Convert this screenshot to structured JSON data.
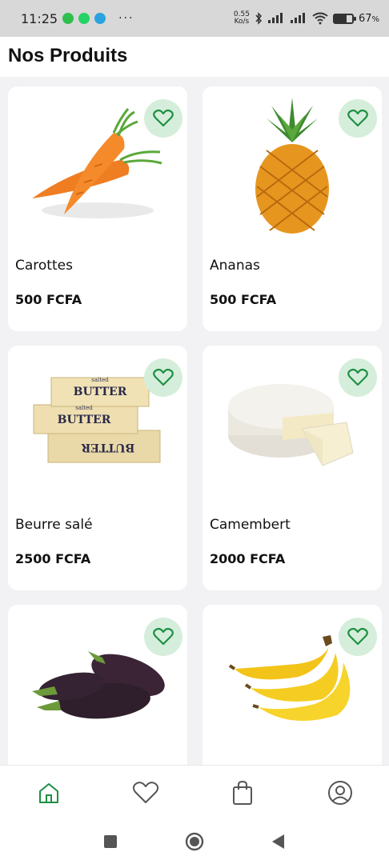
{
  "status_bar": {
    "time": "11:25",
    "apps": [
      "messages-icon",
      "whatsapp-icon",
      "telegram-icon"
    ],
    "more": "···",
    "speed_value": "0.55",
    "speed_unit": "Ko/s",
    "battery_percent": "67",
    "battery_suffix": "%",
    "battery_level": 0.67
  },
  "header": {
    "title": "Nos Produits"
  },
  "colors": {
    "accent": "#1e8f44",
    "fav_bg": "#d5eedb",
    "page_bg": "#f2f2f4"
  },
  "products": [
    {
      "name": "Carottes",
      "price": "500 FCFA",
      "image": "carrot-image"
    },
    {
      "name": "Ananas",
      "price": "500 FCFA",
      "image": "pineapple-image"
    },
    {
      "name": "Beurre salé",
      "price": "2500 FCFA",
      "image": "butter-image"
    },
    {
      "name": "Camembert",
      "price": "2000 FCFA",
      "image": "camembert-image"
    },
    {
      "name": "",
      "price": "",
      "image": "eggplant-image"
    },
    {
      "name": "",
      "price": "",
      "image": "banana-image"
    }
  ],
  "butter_labels": {
    "top": "salted",
    "word": "BUTTER"
  },
  "bottom_nav": [
    "home-icon",
    "heart-icon",
    "bag-icon",
    "account-icon"
  ],
  "system_nav": [
    "recents-button",
    "home-button",
    "back-button"
  ]
}
